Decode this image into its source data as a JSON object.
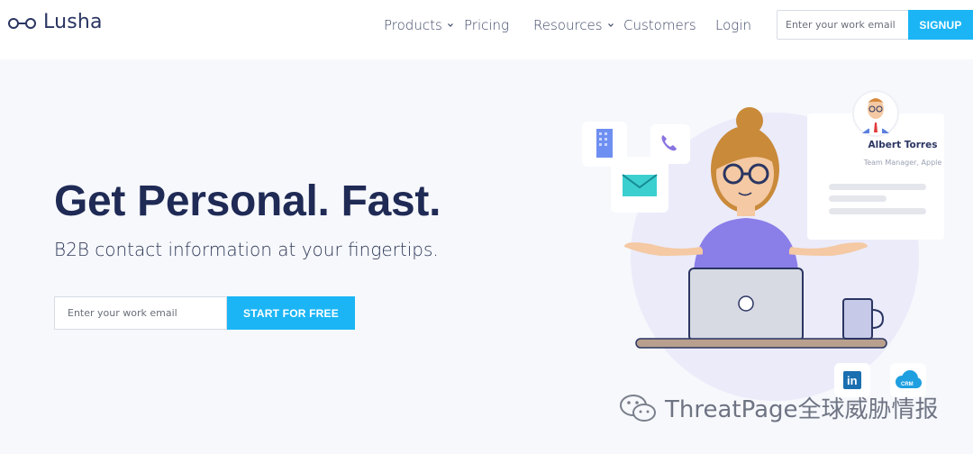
{
  "brand": {
    "name": "Lusha"
  },
  "nav": {
    "items": [
      {
        "label": "Products",
        "has_dropdown": true
      },
      {
        "label": "Pricing",
        "has_dropdown": false
      },
      {
        "label": "Resources",
        "has_dropdown": true
      },
      {
        "label": "Customers",
        "has_dropdown": false
      },
      {
        "label": "Login",
        "has_dropdown": false
      }
    ],
    "email_placeholder": "Enter your work email",
    "signup_label": "SIGNUP"
  },
  "hero": {
    "title": "Get Personal. Fast.",
    "subtitle": "B2B contact information at your fingertips.",
    "email_placeholder": "Enter your work email",
    "cta_label": "START FOR FREE"
  },
  "illustration": {
    "contact_name": "Albert Torres",
    "contact_role": "Team Manager, Apple",
    "icons": [
      "building-icon",
      "phone-icon",
      "envelope-icon",
      "linkedin-icon",
      "crm-cloud-icon"
    ],
    "crm_label": "CRM",
    "linkedin_label": "in"
  },
  "watermark": {
    "text": "ThreatPage全球威胁情报"
  },
  "colors": {
    "accent": "#1bb5f5",
    "heading": "#1f2a55",
    "background": "#f6f8fc"
  }
}
